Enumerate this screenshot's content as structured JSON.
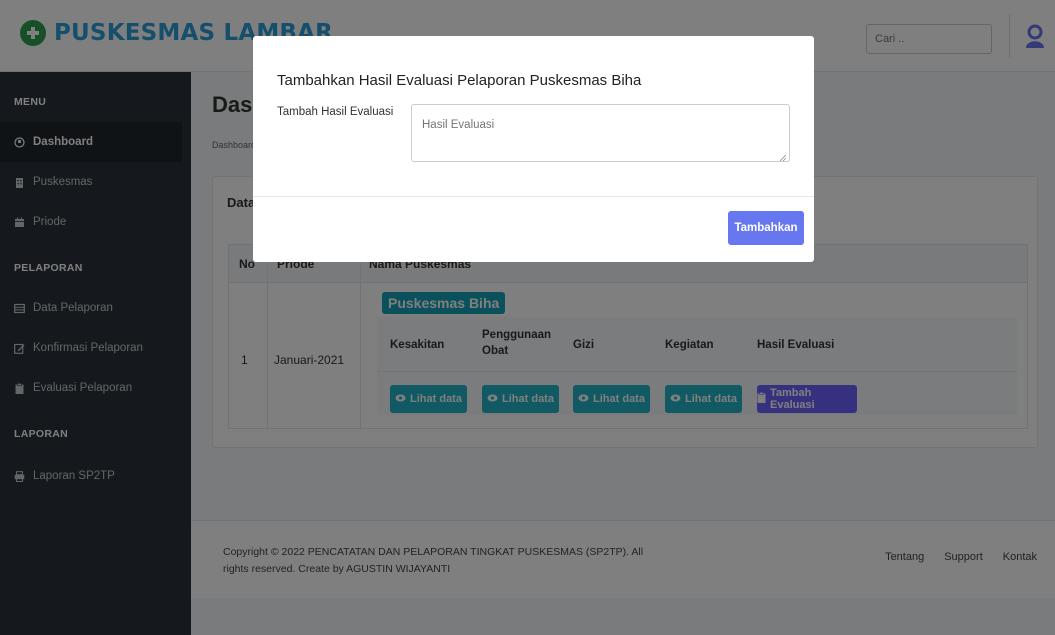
{
  "header": {
    "app_title": "PUSKESMAS LAMBAR",
    "search_placeholder": "Cari .."
  },
  "sidebar": {
    "sections": [
      {
        "heading": "MENU"
      },
      {
        "heading": "PELAPORAN"
      },
      {
        "heading": "LAPORAN"
      }
    ],
    "items": [
      {
        "label": "Dashboard",
        "icon": "user-circle-icon",
        "active": true
      },
      {
        "label": "Puskesmas",
        "icon": "building-icon"
      },
      {
        "label": "Priode",
        "icon": "calendar-icon"
      },
      {
        "label": "Data Pelaporan",
        "icon": "table-icon"
      },
      {
        "label": "Konfirmasi Pelaporan",
        "icon": "edit-icon"
      },
      {
        "label": "Evaluasi Pelaporan",
        "icon": "clipboard-icon"
      },
      {
        "label": "Laporan SP2TP",
        "icon": "printer-icon"
      }
    ]
  },
  "main": {
    "title": "Dash",
    "breadcrumb": "Dashboard",
    "card_title": "Data",
    "table": {
      "headers": [
        "No",
        "Priode",
        "Nama Puskesmas"
      ],
      "rows": [
        {
          "no": "1",
          "priode": "Januari-2021",
          "puskesmas": "Puskesmas Biha",
          "sub_headers": [
            "Kesakitan",
            "Penggunaan Obat",
            "Gizi",
            "Kegiatan",
            "Hasil Evaluasi"
          ],
          "actions": [
            "Lihat data",
            "Lihat data",
            "Lihat data",
            "Lihat data",
            "Tambah Evaluasi"
          ]
        }
      ]
    }
  },
  "footer": {
    "copyright": "Copyright © 2022 PENCATATAN DAN PELAPORAN TINGKAT PUSKESMAS (SP2TP). All rights reserved. Create by AGUSTIN WIJAYANTI",
    "links": [
      "Tentang",
      "Support",
      "Kontak"
    ]
  },
  "modal": {
    "title": "Tambahkan Hasil Evaluasi Pelaporan Puskesmas Biha",
    "field_label": "Tambah Hasil Evaluasi",
    "field_placeholder": "Hasil Evaluasi",
    "submit_label": "Tambahkan"
  },
  "colors": {
    "brand": "#2a9fd6",
    "sidebar": "#2a3138",
    "info_button": "#22b3c7",
    "primary_button": "#6777ef",
    "badge": "#17a2b8"
  }
}
